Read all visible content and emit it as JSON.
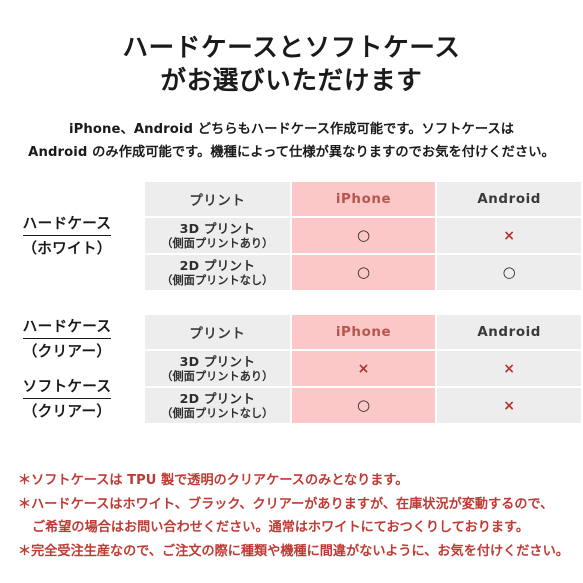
{
  "title": {
    "line1": "ハードケースとソフトケース",
    "line2": "がお選びいただけます"
  },
  "subtitle": {
    "line1": "iPhone、Android どちらもハードケース作成可能です。ソフトケースは",
    "line2": "Android のみ作成可能です。機種によって仕様が異なりますのでお気を付けください。"
  },
  "colors": {
    "pink_cell": "#fbc7c7",
    "gray_cell": "#ededed",
    "accent_red": "#b5564e",
    "cross_red": "#b0342f",
    "note_red": "#bf3a33",
    "text_dark": "#1a1a1a"
  },
  "marks": {
    "circle": "○",
    "cross": "×"
  },
  "groups": [
    {
      "labels": [
        {
          "main": "ハードケース",
          "sub": "（ホワイト）"
        }
      ],
      "headers": {
        "print": "プリント",
        "iphone": "iPhone",
        "android": "Android"
      },
      "rows": [
        {
          "print_l1": "3D プリント",
          "print_l2": "（側面プリントあり）",
          "iphone": "○",
          "android": "×"
        },
        {
          "print_l1": "2D プリント",
          "print_l2": "（側面プリントなし）",
          "iphone": "○",
          "android": "○"
        }
      ]
    },
    {
      "labels": [
        {
          "main": "ハードケース",
          "sub": "（クリアー）"
        },
        {
          "main": "ソフトケース",
          "sub": "（クリアー）"
        }
      ],
      "headers": {
        "print": "プリント",
        "iphone": "iPhone",
        "android": "Android"
      },
      "rows": [
        {
          "print_l1": "3D プリント",
          "print_l2": "（側面プリントあり）",
          "iphone": "×",
          "android": "×"
        },
        {
          "print_l1": "2D プリント",
          "print_l2": "（側面プリントなし）",
          "iphone": "○",
          "android": "×"
        }
      ]
    }
  ],
  "notes": [
    "＊ソフトケースは TPU 製で透明のクリアケースのみとなります。",
    "＊ハードケースはホワイト、ブラック、クリアーがありますが、在庫状況が変動するので、",
    "ご希望の場合はお問い合わせください。通常はホワイトにておつくりしております。",
    "＊完全受注生産なので、ご注文の際に種類や機種に間違がないように、お気を付けください。"
  ]
}
